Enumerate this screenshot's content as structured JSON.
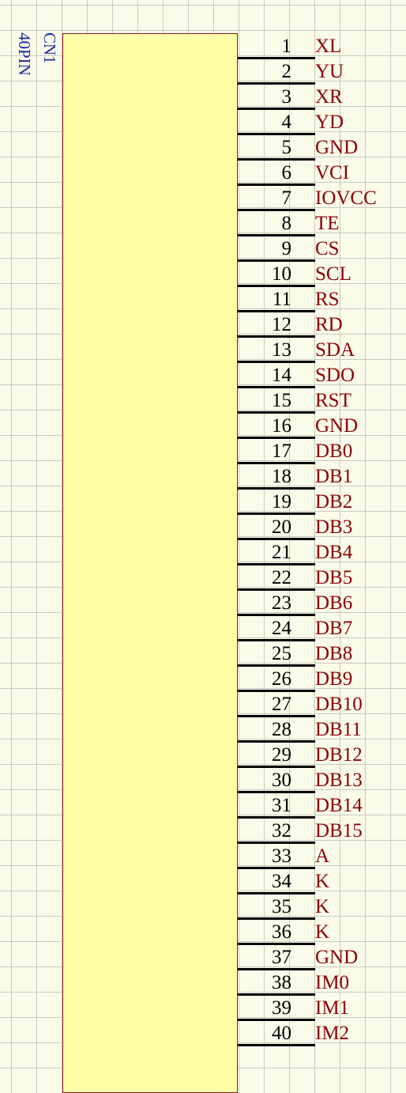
{
  "component": {
    "designator": "CN1",
    "value": "40PIN"
  },
  "pins": [
    {
      "number": "1",
      "name": "XL"
    },
    {
      "number": "2",
      "name": "YU"
    },
    {
      "number": "3",
      "name": "XR"
    },
    {
      "number": "4",
      "name": "YD"
    },
    {
      "number": "5",
      "name": "GND"
    },
    {
      "number": "6",
      "name": "VCI"
    },
    {
      "number": "7",
      "name": "IOVCC"
    },
    {
      "number": "8",
      "name": "TE"
    },
    {
      "number": "9",
      "name": "CS"
    },
    {
      "number": "10",
      "name": "SCL"
    },
    {
      "number": "11",
      "name": "RS"
    },
    {
      "number": "12",
      "name": "RD"
    },
    {
      "number": "13",
      "name": "SDA"
    },
    {
      "number": "14",
      "name": "SDO"
    },
    {
      "number": "15",
      "name": "RST"
    },
    {
      "number": "16",
      "name": "GND"
    },
    {
      "number": "17",
      "name": "DB0"
    },
    {
      "number": "18",
      "name": "DB1"
    },
    {
      "number": "19",
      "name": "DB2"
    },
    {
      "number": "20",
      "name": "DB3"
    },
    {
      "number": "21",
      "name": "DB4"
    },
    {
      "number": "22",
      "name": "DB5"
    },
    {
      "number": "23",
      "name": "DB6"
    },
    {
      "number": "24",
      "name": "DB7"
    },
    {
      "number": "25",
      "name": "DB8"
    },
    {
      "number": "26",
      "name": "DB9"
    },
    {
      "number": "27",
      "name": "DB10"
    },
    {
      "number": "28",
      "name": "DB11"
    },
    {
      "number": "29",
      "name": "DB12"
    },
    {
      "number": "30",
      "name": "DB13"
    },
    {
      "number": "31",
      "name": "DB14"
    },
    {
      "number": "32",
      "name": "DB15"
    },
    {
      "number": "33",
      "name": "A"
    },
    {
      "number": "34",
      "name": "K"
    },
    {
      "number": "35",
      "name": "K"
    },
    {
      "number": "36",
      "name": "K"
    },
    {
      "number": "37",
      "name": "GND"
    },
    {
      "number": "38",
      "name": "IM0"
    },
    {
      "number": "39",
      "name": "IM1"
    },
    {
      "number": "40",
      "name": "IM2"
    }
  ],
  "colors": {
    "component_fill": "#ffffa8",
    "component_border": "#8b1a1a",
    "pin_name": "#8b0000",
    "pin_number": "#000000",
    "designator": "#1c2aa0",
    "grid": "#c9c9c0",
    "sheet": "#fbfbea"
  }
}
